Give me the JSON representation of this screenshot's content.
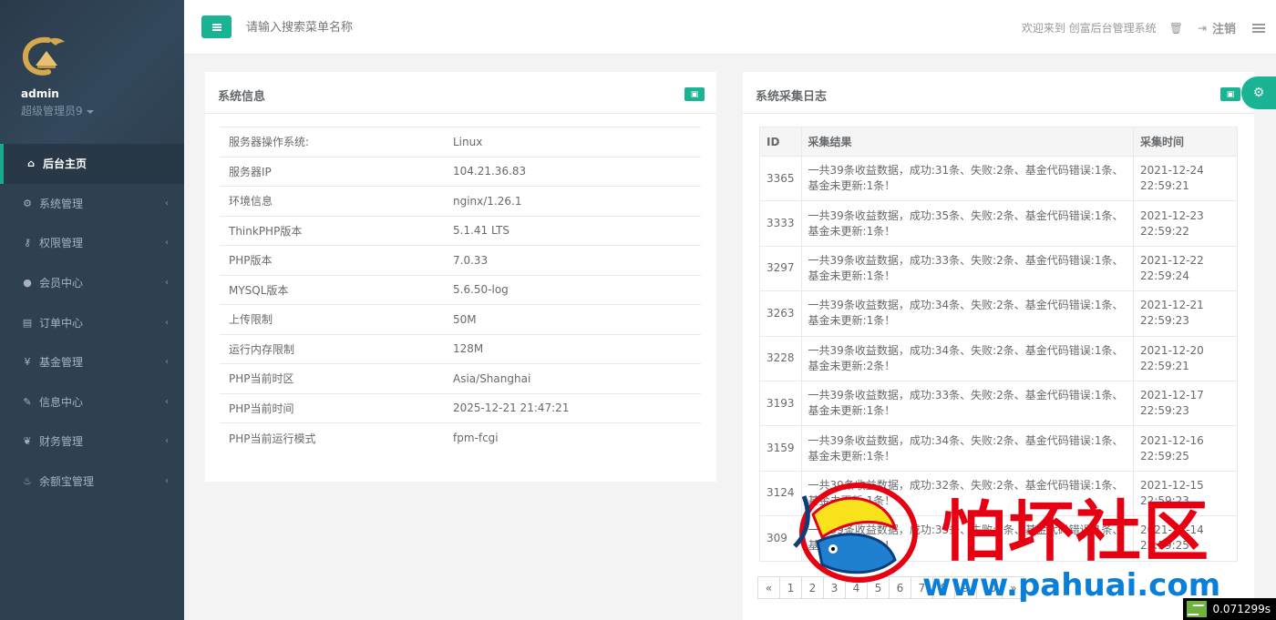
{
  "sidebar": {
    "user": {
      "name": "admin",
      "role": "超级管理员9"
    },
    "items": [
      {
        "label": "后台主页",
        "icon": "home-icon",
        "glyph": "⌂"
      },
      {
        "label": "系统管理",
        "icon": "gears-icon",
        "glyph": "⚙"
      },
      {
        "label": "权限管理",
        "icon": "key-icon",
        "glyph": "⚷"
      },
      {
        "label": "会员中心",
        "icon": "user-icon",
        "glyph": "●"
      },
      {
        "label": "订单中心",
        "icon": "list-icon",
        "glyph": "▤"
      },
      {
        "label": "基金管理",
        "icon": "yen-icon",
        "glyph": "¥"
      },
      {
        "label": "信息中心",
        "icon": "wrench-icon",
        "glyph": "✎"
      },
      {
        "label": "财务管理",
        "icon": "leaf-icon",
        "glyph": "❦"
      },
      {
        "label": "余额宝管理",
        "icon": "fire-icon",
        "glyph": "♨"
      }
    ],
    "chevron": "‹"
  },
  "topbar": {
    "search_placeholder": "请输入搜索菜单名称",
    "welcome": "欢迎来到 创富后台管理系统",
    "logout": "注销"
  },
  "system_info": {
    "title": "系统信息",
    "rows": [
      {
        "k": "服务器操作系统:",
        "v": "Linux"
      },
      {
        "k": "服务器IP",
        "v": "104.21.36.83"
      },
      {
        "k": "环境信息",
        "v": "nginx/1.26.1"
      },
      {
        "k": "ThinkPHP版本",
        "v": "5.1.41 LTS"
      },
      {
        "k": "PHP版本",
        "v": "7.0.33"
      },
      {
        "k": "MYSQL版本",
        "v": "5.6.50-log"
      },
      {
        "k": "上传限制",
        "v": "50M"
      },
      {
        "k": "运行内存限制",
        "v": "128M"
      },
      {
        "k": "PHP当前时区",
        "v": "Asia/Shanghai"
      },
      {
        "k": "PHP当前时间",
        "v": "2025-12-21 21:47:21"
      },
      {
        "k": "PHP当前运行模式",
        "v": "fpm-fcgi"
      }
    ]
  },
  "collect_log": {
    "title": "系统采集日志",
    "headers": [
      "ID",
      "采集结果",
      "采集时间"
    ],
    "rows": [
      {
        "id": "3365",
        "result": "一共39条收益数据，成功:31条、失败:2条、基金代码错误:1条、基金未更新:1条！",
        "date": "2021-12-24",
        "time": "22:59:21"
      },
      {
        "id": "3333",
        "result": "一共39条收益数据，成功:35条、失败:2条、基金代码错误:1条、基金未更新:1条！",
        "date": "2021-12-23",
        "time": "22:59:22"
      },
      {
        "id": "3297",
        "result": "一共39条收益数据，成功:33条、失败:2条、基金代码错误:1条、基金未更新:1条！",
        "date": "2021-12-22",
        "time": "22:59:24"
      },
      {
        "id": "3263",
        "result": "一共39条收益数据，成功:34条、失败:2条、基金代码错误:1条、基金未更新:1条！",
        "date": "2021-12-21",
        "time": "22:59:23"
      },
      {
        "id": "3228",
        "result": "一共39条收益数据，成功:34条、失败:2条、基金代码错误:1条、基金未更新:2条！",
        "date": "2021-12-20",
        "time": "22:59:21"
      },
      {
        "id": "3193",
        "result": "一共39条收益数据，成功:33条、失败:2条、基金代码错误:1条、基金未更新:1条！",
        "date": "2021-12-17",
        "time": "22:59:23"
      },
      {
        "id": "3159",
        "result": "一共39条收益数据，成功:34条、失败:2条、基金代码错误:1条、基金未更新:1条！",
        "date": "2021-12-16",
        "time": "22:59:25"
      },
      {
        "id": "3124",
        "result": "一共39条收益数据，成功:32条、失败:2条、基金代码错误:1条、基金未更新:1条！",
        "date": "2021-12-15",
        "time": "22:59:23"
      },
      {
        "id": "309",
        "result": "一共39条收益数据，成功:33条、失败:2条、基金代码错误:1条、基金未更新:1条！",
        "date": "2021-12-14",
        "time": "22:59:25"
      }
    ],
    "pager": [
      "«",
      "1",
      "2",
      "3",
      "4",
      "5",
      "6",
      "7",
      "8",
      "9",
      "10",
      "»"
    ]
  },
  "timer": "0.071299s",
  "watermark": {
    "text": "怕坏社区",
    "url": "www.pahuai.com"
  },
  "colors": {
    "accent": "#1ab394",
    "sidebar": "#2f4050",
    "sidebar_active": "#293846"
  }
}
